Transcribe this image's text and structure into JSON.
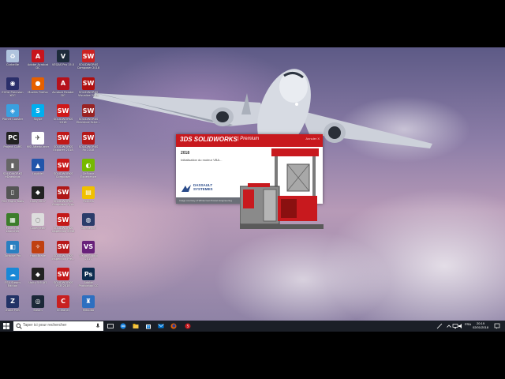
{
  "desktop": {
    "icons": [
      {
        "label": "Corbeille",
        "color": "#b0c4de",
        "glyph": "♻",
        "icon": "recycle-bin-icon"
      },
      {
        "label": "Adobe Acrobat DC",
        "color": "#c8141c",
        "glyph": "A",
        "icon": "acrobat-icon"
      },
      {
        "label": "VEGAS Pro 15.0",
        "color": "#1d2b3a",
        "glyph": "V",
        "icon": "vegas-icon"
      },
      {
        "label": "SOLIDWORKS Composer 2018",
        "color": "#cc2222",
        "glyph": "SW",
        "icon": "sw-composer-icon"
      },
      {
        "label": "EVGA Precision XOC",
        "color": "#2b2f6a",
        "glyph": "◉",
        "icon": "evga-icon"
      },
      {
        "label": "Mozilla Firefox",
        "color": "#e66000",
        "glyph": "●",
        "icon": "firefox-icon"
      },
      {
        "label": "Acrobat Reader DC",
        "color": "#b5121b",
        "glyph": "A",
        "icon": "acrobat-reader-icon"
      },
      {
        "label": "SOLIDWORKS Visualize 2018",
        "color": "#b01010",
        "glyph": "SW",
        "icon": "sw-visualize-icon"
      },
      {
        "label": "Planet Coaster",
        "color": "#3aa0e0",
        "glyph": "◈",
        "icon": "planet-coaster-icon"
      },
      {
        "label": "Skype",
        "color": "#00aff0",
        "glyph": "S",
        "icon": "skype-icon"
      },
      {
        "label": "SOLIDWORKS 2018",
        "color": "#d01818",
        "glyph": "SW",
        "icon": "solidworks-icon"
      },
      {
        "label": "SOLIDWORKS Electrical Sche…",
        "color": "#992222",
        "glyph": "SW",
        "icon": "sw-electrical-icon"
      },
      {
        "label": "Project CARS",
        "color": "#222222",
        "glyph": "PC",
        "icon": "project-cars-icon"
      },
      {
        "label": "MSI Afterburner",
        "color": "#ffffff",
        "glyph": "✈",
        "icon": "afterburner-icon"
      },
      {
        "label": "SOLIDWORKS Explorer 2018",
        "color": "#c01818",
        "glyph": "SW",
        "icon": "sw-explorer-icon"
      },
      {
        "label": "SOLIDWORKS Rx 2018",
        "color": "#b51818",
        "glyph": "SW",
        "icon": "sw-rx-icon"
      },
      {
        "label": "SOLIDWORKS eDrawings",
        "color": "#666666",
        "glyph": "▮",
        "icon": "edrawings-icon"
      },
      {
        "label": "Logiciel",
        "color": "#2255aa",
        "glyph": "▲",
        "icon": "logiciel-icon"
      },
      {
        "label": "SOLIDWORKS Composer",
        "color": "#c81818",
        "glyph": "SW",
        "icon": "sw-composer2-icon"
      },
      {
        "label": "GeForce Experience",
        "color": "#76b900",
        "glyph": "◐",
        "icon": "geforce-icon"
      },
      {
        "label": "FSX Flight Tools",
        "color": "#555555",
        "glyph": "▯",
        "icon": "fsx-icon"
      },
      {
        "label": "Unity 2017",
        "color": "#222222",
        "glyph": "◆",
        "icon": "unity-icon"
      },
      {
        "label": "SOLIDWORKS Composer Sync",
        "color": "#b01818",
        "glyph": "SW",
        "icon": "sw-sync-icon"
      },
      {
        "label": "Fichiers",
        "color": "#f0c000",
        "glyph": "▤",
        "icon": "files-icon"
      },
      {
        "label": "Minecraft Launcher",
        "color": "#3c7d2a",
        "glyph": "▦",
        "icon": "minecraft-icon"
      },
      {
        "label": "CodeMeter",
        "color": "#dddddd",
        "glyph": "◌",
        "icon": "codemeter-icon"
      },
      {
        "label": "SOLIDWORKS Inspection 2018",
        "color": "#c41818",
        "glyph": "SW",
        "icon": "sw-inspection-icon"
      },
      {
        "label": "Cinebench",
        "color": "#2b3c6a",
        "glyph": "◍",
        "icon": "cinebench-icon"
      },
      {
        "label": "Tortoise Pro",
        "color": "#2a7fc0",
        "glyph": "◧",
        "icon": "tortoise-icon"
      },
      {
        "label": "HandBrake",
        "color": "#c04010",
        "glyph": "✧",
        "icon": "handbrake-icon"
      },
      {
        "label": "SOLIDWORKS Inspection Pre…",
        "color": "#b81818",
        "glyph": "SW",
        "icon": "sw-inspection2-icon"
      },
      {
        "label": "Visual Studio 2017",
        "color": "#68217a",
        "glyph": "VS",
        "icon": "visual-studio-icon"
      },
      {
        "label": "FSX Steam Edition",
        "color": "#1a88d6",
        "glyph": "☁",
        "icon": "fsx-steam-icon"
      },
      {
        "label": "Unity 5.6.4f1",
        "color": "#222222",
        "glyph": "◆",
        "icon": "unity2-icon"
      },
      {
        "label": "SOLIDWORKS PCB 2018",
        "color": "#c51818",
        "glyph": "SW",
        "icon": "sw-pcb-icon"
      },
      {
        "label": "Adobe Photoshop CC",
        "color": "#0d2d4f",
        "glyph": "Ps",
        "icon": "photoshop-icon"
      },
      {
        "label": "Zuna PCB",
        "color": "#223366",
        "glyph": "Z",
        "icon": "zuna-icon"
      },
      {
        "label": "Steam",
        "color": "#1b2838",
        "glyph": "◎",
        "icon": "steam-icon"
      },
      {
        "label": "CCleaner",
        "color": "#c82020",
        "glyph": "C",
        "icon": "ccleaner-icon"
      },
      {
        "label": "Mitsuba",
        "color": "#2d6fc0",
        "glyph": "♜",
        "icon": "mitsuba-icon"
      }
    ]
  },
  "splash": {
    "logo": "3DS SOLIDWORKS",
    "edition": "| Premium",
    "close": "Annuler X",
    "year": "2018",
    "status": "Initialisation du moteur VBA...",
    "vendor": "DASSAULT SYSTEMES",
    "footer": "Image courtesy of Whitecrest Product Engineering"
  },
  "taskbar": {
    "search_placeholder": "Taper ici pour rechercher",
    "language": "FRA",
    "time": "20:19",
    "date": "02/01/2018"
  }
}
